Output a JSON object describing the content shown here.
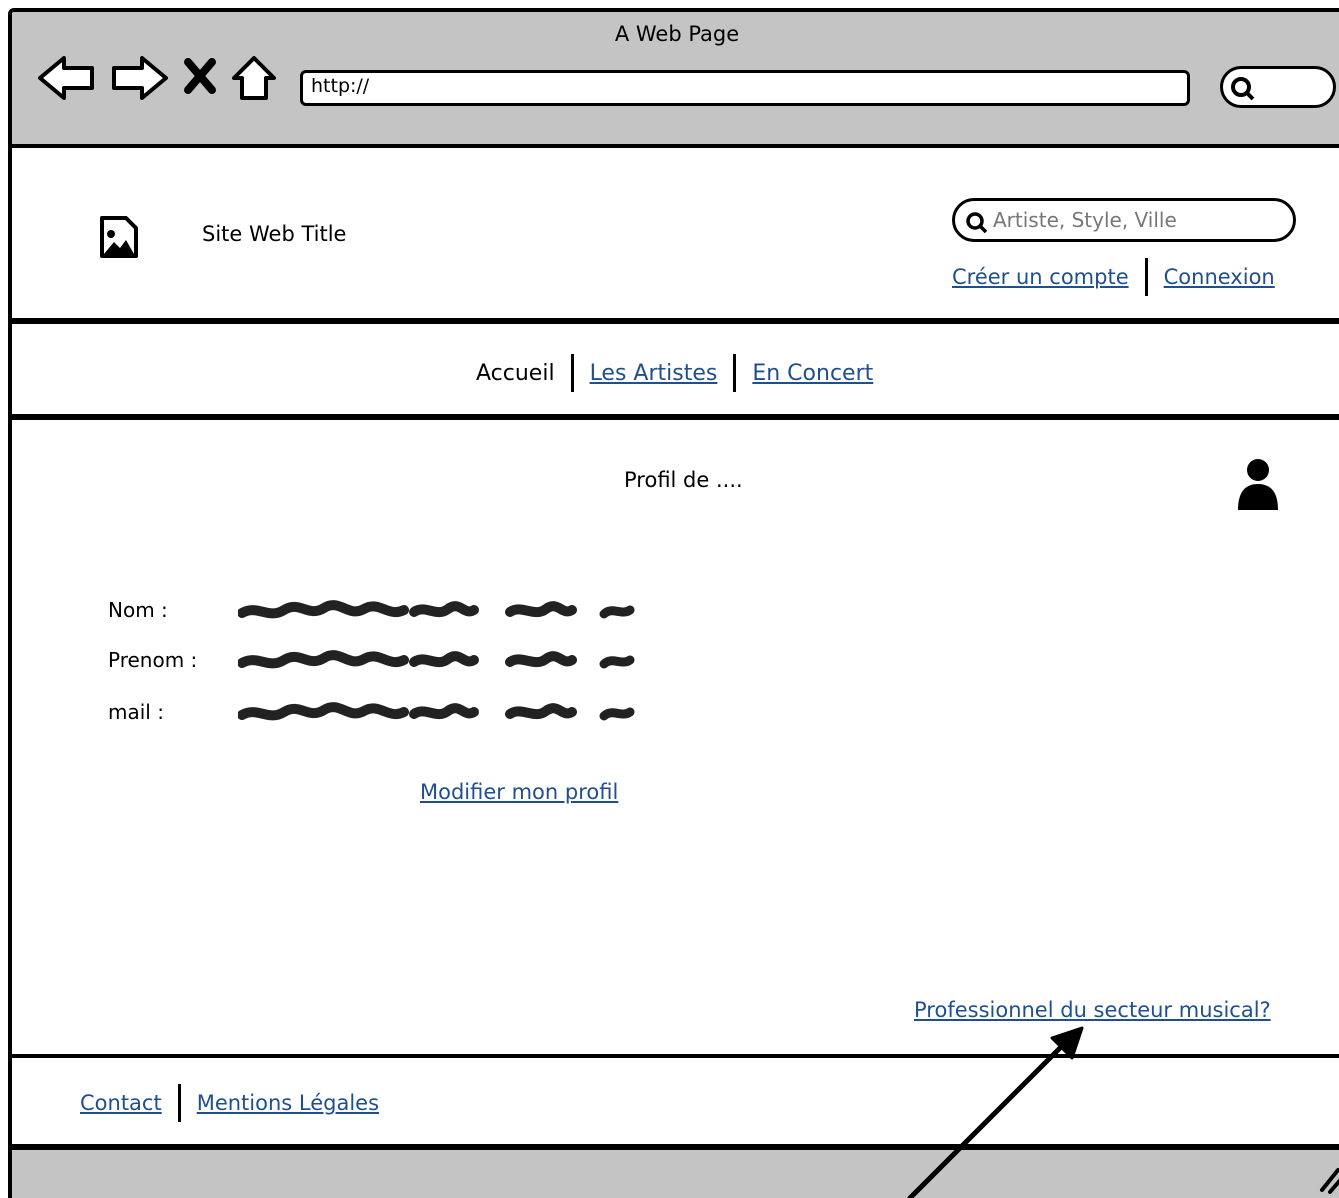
{
  "window": {
    "title": "A Web Page",
    "url": "http://"
  },
  "icons": {
    "back": "back-arrow-icon",
    "forward": "forward-arrow-icon",
    "stop": "close-icon",
    "home": "home-icon",
    "search": "search-icon",
    "logo": "image-icon",
    "user": "user-icon",
    "grip": "resize-grip-icon"
  },
  "header": {
    "site_title": "Site Web Title",
    "search_placeholder": "Artiste, Style, Ville",
    "create_account": "Créer un compte",
    "login": "Connexion"
  },
  "nav": {
    "items": [
      {
        "label": "Accueil"
      },
      {
        "label": "Les Artistes"
      },
      {
        "label": "En Concert"
      }
    ]
  },
  "profile": {
    "title": "Profil de ....",
    "fields": [
      {
        "label": "Nom :"
      },
      {
        "label": "Prenom :"
      },
      {
        "label": "mail :"
      }
    ],
    "edit_link": "Modifier mon profil",
    "pro_link": "Professionnel du secteur musical?"
  },
  "footer": {
    "contact": "Contact",
    "legal": "Mentions Légales"
  },
  "colors": {
    "link": "#1f4f8f",
    "chrome": "#c4c4c4"
  }
}
